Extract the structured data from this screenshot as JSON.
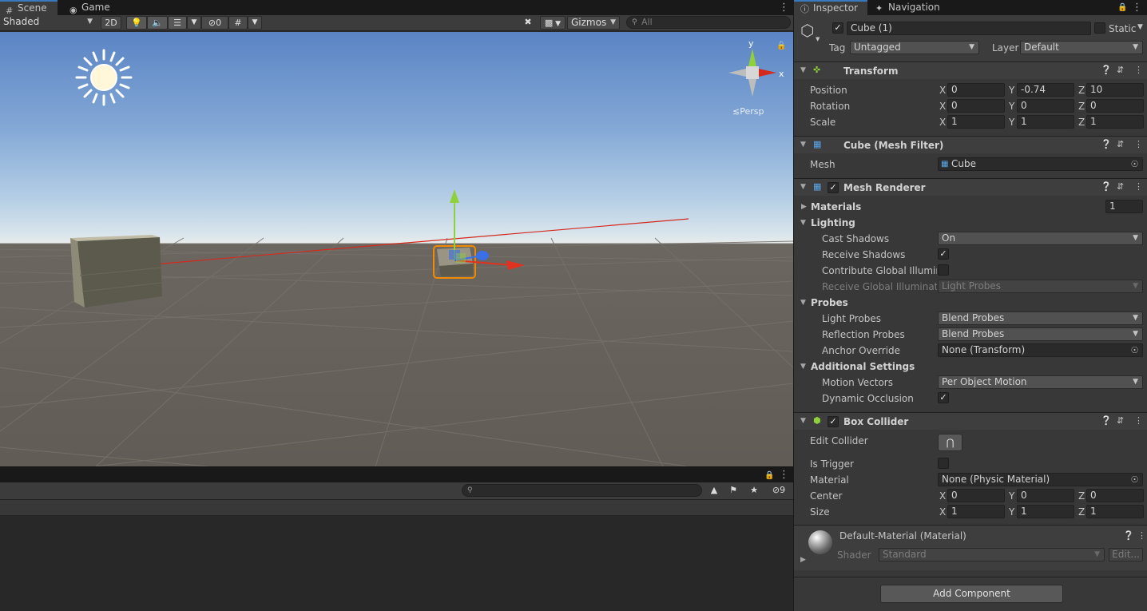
{
  "scene_tabs": {
    "scene": "Scene",
    "game": "Game"
  },
  "scene_toolbar": {
    "draw_mode": "Shaded",
    "mode_2d": "2D",
    "hidden_count": "0",
    "gizmos": "Gizmos",
    "search_placeholder": "All"
  },
  "viewport": {
    "projection_label": "Persp",
    "gizmo_x": "x",
    "gizmo_y": "y"
  },
  "lower_panel": {
    "search_placeholder": "",
    "hidden_count": "9"
  },
  "inspector_tabs": {
    "inspector": "Inspector",
    "navigation": "Navigation"
  },
  "object": {
    "name": "Cube (1)",
    "static_label": "Static",
    "tag_label": "Tag",
    "tag_value": "Untagged",
    "layer_label": "Layer",
    "layer_value": "Default"
  },
  "transform": {
    "title": "Transform",
    "rows": [
      {
        "label": "Position",
        "x": "0",
        "y": "-0.74",
        "z": "10"
      },
      {
        "label": "Rotation",
        "x": "0",
        "y": "0",
        "z": "0"
      },
      {
        "label": "Scale",
        "x": "1",
        "y": "1",
        "z": "1"
      }
    ]
  },
  "axes": {
    "x": "X",
    "y": "Y",
    "z": "Z"
  },
  "mesh_filter": {
    "title": "Cube (Mesh Filter)",
    "mesh_label": "Mesh",
    "mesh_value": "Cube"
  },
  "mesh_renderer": {
    "title": "Mesh Renderer",
    "materials_label": "Materials",
    "materials_count": "1",
    "lighting_label": "Lighting",
    "cast_shadows_label": "Cast Shadows",
    "cast_shadows_value": "On",
    "receive_shadows_label": "Receive Shadows",
    "contribute_gi_label": "Contribute Global Illumina",
    "receive_gi_label": "Receive Global Illuminatic",
    "receive_gi_value": "Light Probes",
    "probes_label": "Probes",
    "light_probes_label": "Light Probes",
    "light_probes_value": "Blend Probes",
    "reflection_probes_label": "Reflection Probes",
    "reflection_probes_value": "Blend Probes",
    "anchor_override_label": "Anchor Override",
    "anchor_override_value": "None (Transform)",
    "additional_label": "Additional Settings",
    "motion_vectors_label": "Motion Vectors",
    "motion_vectors_value": "Per Object Motion",
    "dynamic_occlusion_label": "Dynamic Occlusion"
  },
  "box_collider": {
    "title": "Box Collider",
    "edit_collider_label": "Edit Collider",
    "is_trigger_label": "Is Trigger",
    "material_label": "Material",
    "material_value": "None (Physic Material)",
    "center_label": "Center",
    "center": {
      "x": "0",
      "y": "0",
      "z": "0"
    },
    "size_label": "Size",
    "size": {
      "x": "1",
      "y": "1",
      "z": "1"
    }
  },
  "material": {
    "title": "Default-Material (Material)",
    "shader_label": "Shader",
    "shader_value": "Standard",
    "edit_label": "Edit..."
  },
  "add_component": "Add Component",
  "colors": {
    "accent": "#3a79bb",
    "selection": "#f08a00",
    "x_axis": "#e0321e",
    "y_axis": "#8fd13a",
    "z_axis": "#3a6fe6"
  }
}
